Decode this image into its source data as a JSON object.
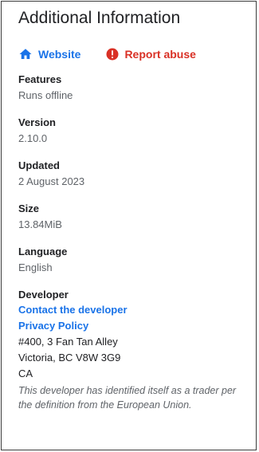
{
  "section_title": "Additional Information",
  "links": {
    "website": {
      "label": "Website",
      "icon": "home-icon",
      "color": "#1a73e8"
    },
    "report": {
      "label": "Report abuse",
      "icon": "alert-icon",
      "color": "#d93025"
    }
  },
  "details": [
    {
      "label": "Features",
      "value": "Runs offline"
    },
    {
      "label": "Version",
      "value": "2.10.0"
    },
    {
      "label": "Updated",
      "value": "2 August 2023"
    },
    {
      "label": "Size",
      "value": "13.84MiB"
    },
    {
      "label": "Language",
      "value": "English"
    }
  ],
  "developer": {
    "label": "Developer",
    "contact_link": "Contact the developer",
    "privacy_link": "Privacy Policy",
    "address": [
      "#400, 3 Fan Tan Alley",
      "Victoria, BC V8W 3G9",
      "CA"
    ],
    "trader_note": "This developer has identified itself as a trader per the definition from the European Union."
  }
}
